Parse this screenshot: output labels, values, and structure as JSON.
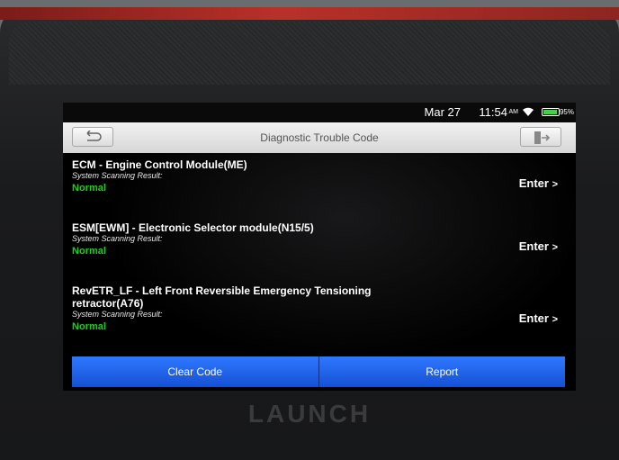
{
  "status_bar": {
    "date": "Mar 27",
    "time": "11:54",
    "ampm": "AM",
    "battery_percent": "95%",
    "battery_level": 0.95,
    "icons": [
      "wifi-icon",
      "battery-icon"
    ]
  },
  "header": {
    "title": "Diagnostic Trouble Code",
    "back_icon": "back-arrow-icon",
    "exit_icon": "exit-icon"
  },
  "modules": [
    {
      "name": "ECM - Engine Control Module(ME)",
      "scan_label": "System Scanning Result:",
      "status": "Normal",
      "enter_label": "Enter",
      "enter_icon": "chevron-right-icon"
    },
    {
      "name": "ESM[EWM] - Electronic Selector module(N15/5)",
      "scan_label": "System Scanning Result:",
      "status": "Normal",
      "enter_label": "Enter",
      "enter_icon": "chevron-right-icon"
    },
    {
      "name": "RevETR_LF - Left Front Reversible Emergency Tensioning retractor(A76)",
      "scan_label": "System Scanning Result:",
      "status": "Normal",
      "enter_label": "Enter",
      "enter_icon": "chevron-right-icon"
    }
  ],
  "footer": {
    "clear_code_label": "Clear Code",
    "report_label": "Report"
  },
  "device": {
    "brand": "LAUNCH"
  },
  "colors": {
    "status_normal": "#17d317",
    "button_blue": "#2f78ff",
    "title_bar": "#e6e6e6",
    "device_accent": "#b9302a"
  }
}
